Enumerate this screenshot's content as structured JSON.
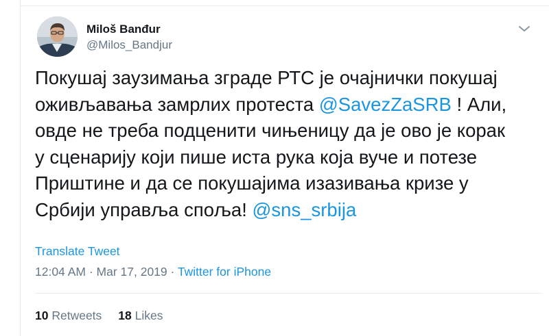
{
  "author": {
    "display_name": "Miloš Banđur",
    "handle": "@Milos_Bandjur"
  },
  "tweet": {
    "lines": [
      [
        "Покушај заузимања зграде РТС је очајнички покушај"
      ],
      [
        "оживљавања замрлих протеста ",
        "@SavezZaSRB",
        " !  Али,"
      ],
      [
        "овде не треба подценити чињеницу да је ово је корак"
      ],
      [
        "у сценарију који пише иста рука која вуче и потезе"
      ],
      [
        "Приштине и да се покушајима изазивања кризе у"
      ],
      [
        "Србији управља споља! ",
        "@sns_srbija"
      ]
    ],
    "mentions": [
      "@SavezZaSRB",
      "@sns_srbija"
    ]
  },
  "translate_label": "Translate Tweet",
  "meta": {
    "time": "12:04 AM",
    "separator": " · ",
    "date": "Mar 17, 2019",
    "source": "Twitter for iPhone"
  },
  "stats": {
    "retweets_count": "10",
    "retweets_label": "Retweets",
    "likes_count": "18",
    "likes_label": "Likes"
  },
  "icons": {
    "more": "chevron-down-icon"
  },
  "colors": {
    "link": "#1b95e0",
    "secondary_text": "#657786",
    "primary_text": "#14171a",
    "divider": "#e6ecf0"
  }
}
